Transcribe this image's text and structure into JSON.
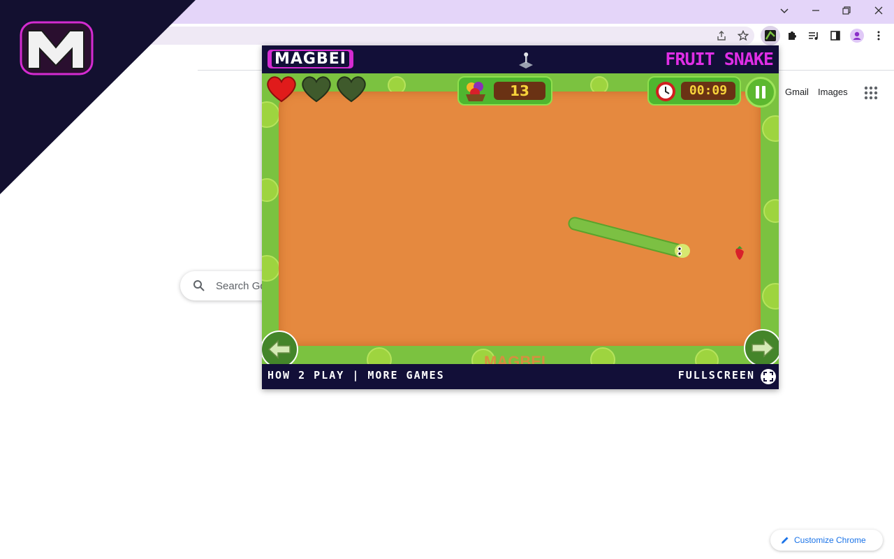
{
  "browser": {
    "window_controls": [
      "chevron-down-icon",
      "minimize-icon",
      "restore-icon",
      "close-icon"
    ],
    "toolbar_icons": [
      "share-icon",
      "bookmark-star-icon",
      "magbei-extension-icon",
      "puzzle-icon",
      "media-queue-icon",
      "side-panel-icon",
      "profile-avatar-icon",
      "more-vert-icon"
    ]
  },
  "ntp": {
    "gmail_label": "Gmail",
    "images_label": "Images",
    "search_placeholder": "Search Google or type a URL",
    "customize_label": "Customize Chrome"
  },
  "game": {
    "brand": "MAGBEI",
    "title": "FRUIT SNAKE",
    "lives_total": 3,
    "lives_remaining": 1,
    "score": "13",
    "timer": "00:09",
    "footer_left": "HOW 2 PLAY | MORE GAMES",
    "footer_right": "FULLSCREEN",
    "watermark": "MAGBEI"
  },
  "colors": {
    "titlebar": "#e4d5f9",
    "game_header": "#120f38",
    "game_title": "#e02ee6",
    "sand": "#e5893f",
    "grass": "#7bc240",
    "link_blue": "#1a73e8"
  }
}
